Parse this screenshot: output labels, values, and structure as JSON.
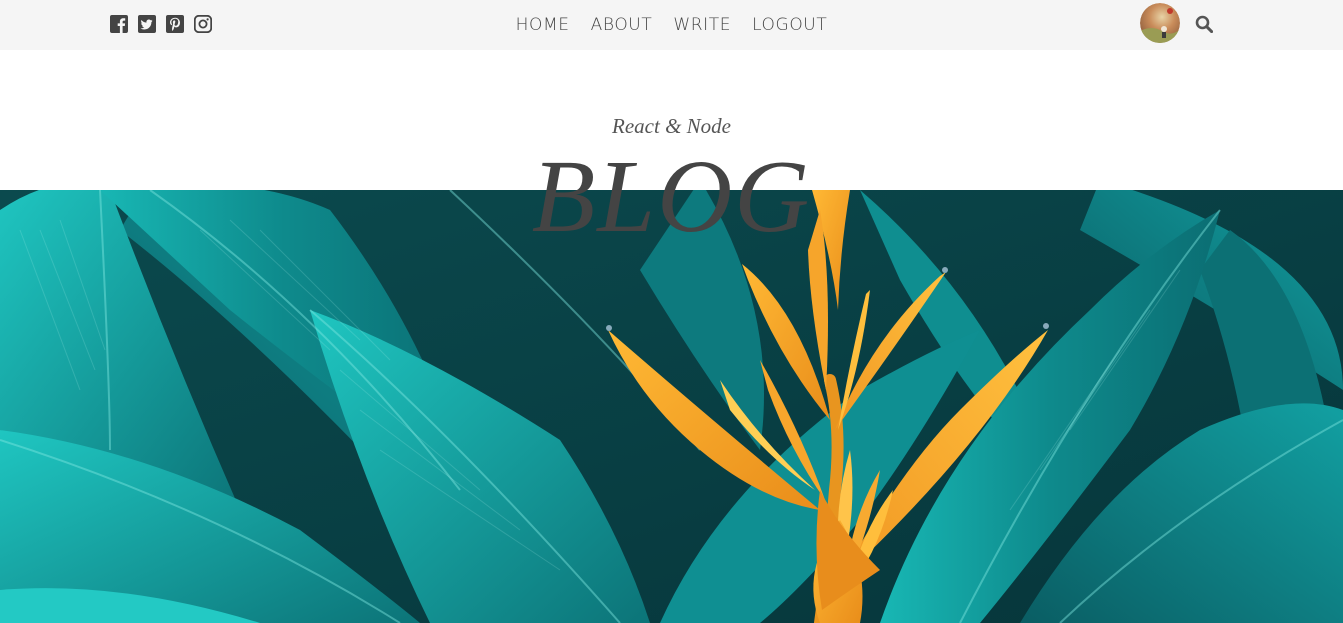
{
  "header": {
    "social_icons": [
      "facebook-square-icon",
      "twitter-square-icon",
      "pinterest-square-icon",
      "instagram-icon"
    ],
    "nav": [
      "HOME",
      "ABOUT",
      "WRITE",
      "LOGOUT"
    ],
    "right_icons": [
      "avatar",
      "search-icon"
    ]
  },
  "hero": {
    "subtitle": "React & Node",
    "title": "BLOG"
  },
  "colors": {
    "topbar_bg": "#f5f5f5",
    "nav_text": "#444444",
    "title_text": "#444444",
    "leaf_teal": "#1aa6a6",
    "flower_orange": "#f5a623"
  }
}
